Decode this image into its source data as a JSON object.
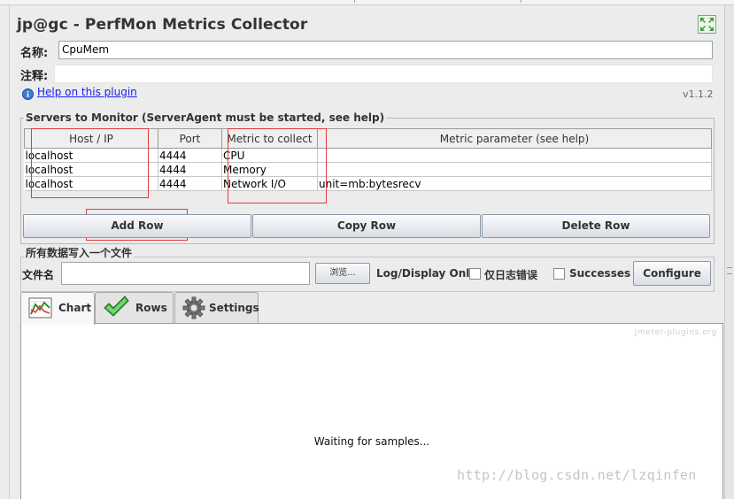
{
  "title": "jp@gc - PerfMon Metrics Collector",
  "name_label": "名称:",
  "name_value": "CpuMem",
  "comment_label": "注释:",
  "comment_value": "",
  "help_link": "Help on this plugin",
  "version": "v1.1.2",
  "servers": {
    "title": "Servers to Monitor (ServerAgent must be started, see help)",
    "columns": [
      "Host / IP",
      "Port",
      "Metric to collect",
      "Metric parameter (see help)"
    ],
    "rows": [
      [
        "localhost",
        "4444",
        "CPU",
        ""
      ],
      [
        "localhost",
        "4444",
        "Memory",
        ""
      ],
      [
        "localhost",
        "4444",
        "Network I/O",
        "unit=mb:bytesrecv"
      ]
    ]
  },
  "buttons": {
    "add_row": "Add Row",
    "copy_row": "Copy Row",
    "delete_row": "Delete Row"
  },
  "file_section": {
    "title": "所有数据写入一个文件",
    "filename_label": "文件名",
    "filename_value": "",
    "browse": "浏览...",
    "log_display": "Log/Display Only:",
    "errors_only": "仅日志错误",
    "errors_only_checked": false,
    "successes": "Successes",
    "successes_checked": false,
    "configure": "Configure"
  },
  "tabs": [
    {
      "label": "Chart",
      "icon": "chart-icon",
      "active": true
    },
    {
      "label": "Rows",
      "icon": "checkmark-icon",
      "active": false
    },
    {
      "label": "Settings",
      "icon": "gear-icon",
      "active": false
    }
  ],
  "chart": {
    "watermark": "jmeter-plugins.org",
    "waiting_text": "Waiting for samples..."
  },
  "page_watermark": "http://blog.csdn.net/lzqinfen",
  "colors": {
    "link": "#1a1aee",
    "annotation_box": "#e23b3b",
    "background": "#ececec"
  }
}
